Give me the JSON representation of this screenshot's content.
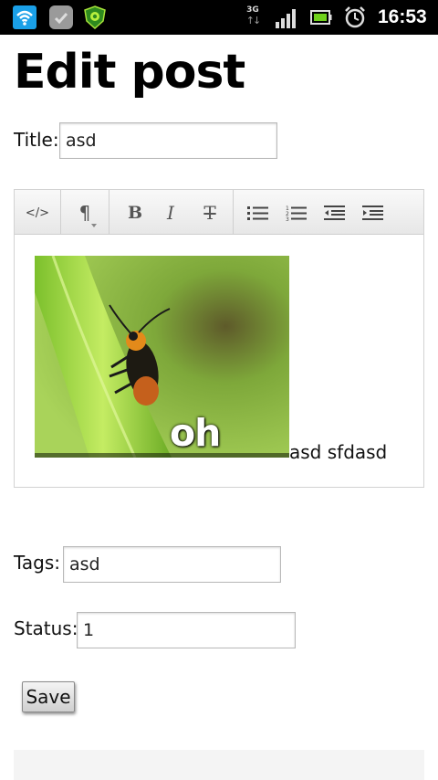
{
  "status_bar": {
    "network": "3G",
    "network_arrows": "↑↓",
    "time": "16:53",
    "icons": [
      "wifi-icon",
      "message-icon",
      "shield-icon",
      "signal-icon",
      "battery-icon",
      "alarm-icon"
    ]
  },
  "page": {
    "title": "Edit post"
  },
  "form": {
    "title_label": "Title:",
    "title_value": "asd",
    "tags_label": "Tags:",
    "tags_value": "asd",
    "status_label": "Status:",
    "status_value": "1",
    "save_label": "Save"
  },
  "editor": {
    "toolbar": {
      "source": "</>",
      "paragraph": "¶",
      "bold": "B",
      "italic": "I",
      "strikethrough": "T"
    },
    "image_caption": "oh hai",
    "body_text": "asd sfdasd"
  }
}
